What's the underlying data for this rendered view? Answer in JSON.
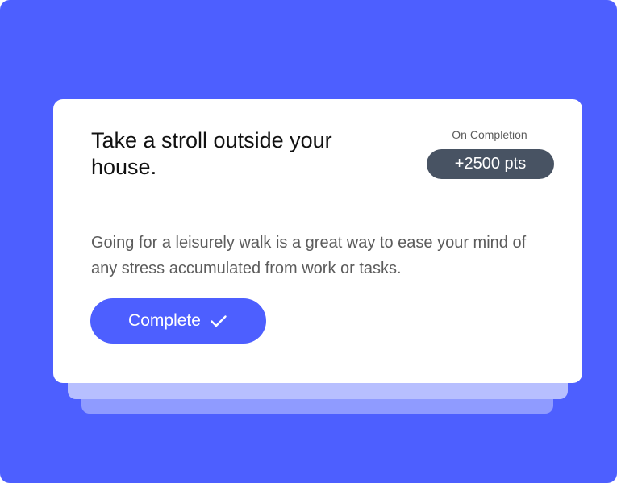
{
  "task": {
    "title": "Take a stroll outside your house.",
    "description": "Going for a leisurely walk is a great way to ease your mind of any stress accumulated from work or tasks."
  },
  "reward": {
    "label": "On Completion",
    "points": "+2500 pts"
  },
  "actions": {
    "complete_label": "Complete",
    "complete_icon": "check-icon"
  },
  "colors": {
    "background": "#4D5FFF",
    "card": "#FFFFFF",
    "stack_light": "#B7BFFF",
    "stack_mid": "#8F9BFF",
    "badge": "#485363",
    "button": "#4D5FFF",
    "title_text": "#111111",
    "secondary_text": "#5C5C5C"
  }
}
